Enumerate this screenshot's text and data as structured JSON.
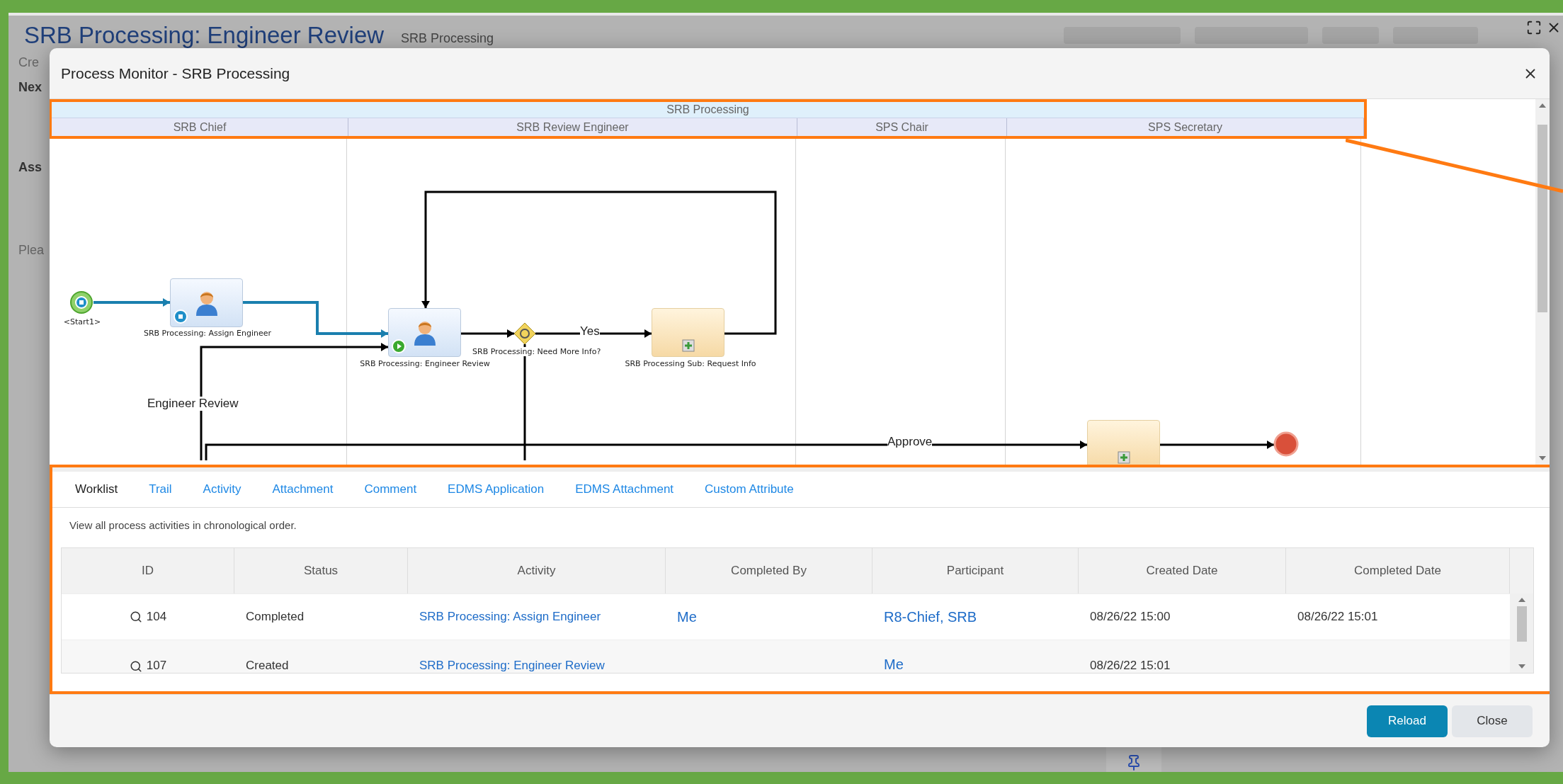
{
  "background_page": {
    "title": "SRB Processing: Engineer Review",
    "subtitle": "SRB Processing",
    "fragments": [
      "Cre",
      "Nex",
      "Ass",
      "Plea"
    ]
  },
  "dialog": {
    "title": "Process Monitor - SRB Processing"
  },
  "diagram": {
    "pool": "SRB Processing",
    "lanes": [
      "SRB Chief",
      "SRB Review Engineer",
      "SPS Chair",
      "SPS Secretary"
    ],
    "nodes": [
      {
        "kind": "start",
        "label": "<Start1>"
      },
      {
        "kind": "task",
        "label": "SRB Processing: Assign Engineer",
        "running": false
      },
      {
        "kind": "task",
        "label": "SRB Processing: Engineer Review",
        "running": true
      },
      {
        "kind": "gateway",
        "label": "SRB Processing: Need More Info?"
      },
      {
        "kind": "subprocess",
        "label": "SRB Processing Sub: Request Info"
      },
      {
        "kind": "subprocess"
      },
      {
        "kind": "end"
      }
    ],
    "flow_labels": [
      "Yes",
      "Engineer Review",
      "Approve"
    ]
  },
  "tabs": [
    {
      "label": "Worklist",
      "selected": true
    },
    {
      "label": "Trail",
      "selected": false
    },
    {
      "label": "Activity",
      "selected": false
    },
    {
      "label": "Attachment",
      "selected": false
    },
    {
      "label": "Comment",
      "selected": false
    },
    {
      "label": "EDMS Application",
      "selected": false
    },
    {
      "label": "EDMS Attachment",
      "selected": false
    },
    {
      "label": "Custom Attribute",
      "selected": false
    }
  ],
  "description": "View all process activities in chronological order.",
  "table": {
    "columns": [
      "ID",
      "Status",
      "Activity",
      "Completed By",
      "Participant",
      "Created Date",
      "Completed Date"
    ],
    "rows": [
      {
        "id": "104",
        "status": "Completed",
        "activity": "SRB Processing: Assign Engineer",
        "completed_by": "Me",
        "participant": "R8-Chief, SRB",
        "created_date": "08/26/22 15:00",
        "completed_date": "08/26/22 15:01"
      },
      {
        "id": "107",
        "status": "Created",
        "activity": "SRB Processing: Engineer Review",
        "participant": "Me",
        "created_date": "08/26/22 15:01"
      }
    ]
  },
  "buttons": [
    {
      "kind": "primary",
      "label": "Reload"
    },
    {
      "kind": "secondary",
      "label": "Close"
    }
  ]
}
